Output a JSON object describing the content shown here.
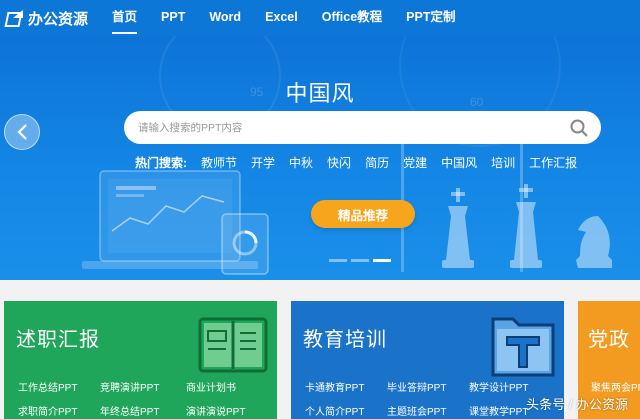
{
  "brand": {
    "logo_text": "办公资源"
  },
  "nav": [
    {
      "label": "首页",
      "active": true
    },
    {
      "label": "PPT"
    },
    {
      "label": "Word"
    },
    {
      "label": "Excel"
    },
    {
      "label": "Office教程"
    },
    {
      "label": "PPT定制"
    }
  ],
  "banner": {
    "title": "中国风",
    "search_placeholder": "请输入搜索的PPT内容",
    "hot_label": "热门搜索:",
    "hot_tags": [
      "教师节",
      "开学",
      "中秋",
      "快闪",
      "简历",
      "党建",
      "中国风",
      "培训",
      "工作汇报"
    ],
    "cta_label": "精品推荐",
    "slide_count": 3,
    "active_slide": 3
  },
  "cards": [
    {
      "title": "述职汇报",
      "color": "#1fa65a",
      "links": [
        "工作总结PPT",
        "竞聘演讲PPT",
        "商业计划书",
        "求职简介PPT",
        "年终总结PPT",
        "演讲演说PPT"
      ]
    },
    {
      "title": "教育培训",
      "color": "#1a73c9",
      "links": [
        "卡通教育PPT",
        "毕业答辩PPT",
        "教学设计PPT",
        "个人简介PPT",
        "主题班会PPT",
        "课堂教学PPT"
      ]
    },
    {
      "title": "党政",
      "color": "#f39a20",
      "links": [
        "聚焦两会PPT"
      ]
    }
  ],
  "watermark": "头条号 / 办公资源",
  "colors": {
    "nav_bg": "#0d77d8",
    "cta": "#f7a51c"
  }
}
